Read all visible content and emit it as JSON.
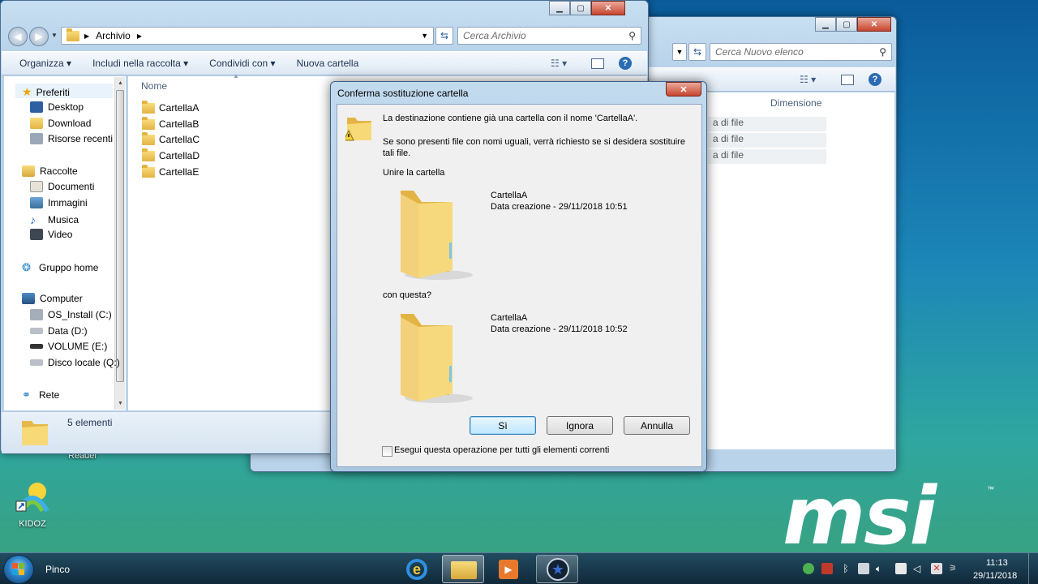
{
  "explorer": {
    "breadcrumb": "Archivio",
    "search_placeholder": "Cerca Archivio",
    "toolbar": {
      "organize": "Organizza",
      "include": "Includi nella raccolta",
      "share": "Condividi con",
      "new_folder": "Nuova cartella"
    },
    "sidebar": {
      "favorites": "Preferiti",
      "desktop": "Desktop",
      "download": "Download",
      "recent": "Risorse recenti",
      "libraries": "Raccolte",
      "documents": "Documenti",
      "images": "Immagini",
      "music": "Musica",
      "video": "Video",
      "homegroup": "Gruppo home",
      "computer": "Computer",
      "drive_c": "OS_Install (C:)",
      "drive_d": "Data (D:)",
      "drive_e": "VOLUME (E:)",
      "drive_q": "Disco locale (Q:)",
      "network": "Rete"
    },
    "column_name": "Nome",
    "files": [
      "CartellaA",
      "CartellaB",
      "CartellaC",
      "CartellaD",
      "CartellaE"
    ],
    "status": "5 elementi"
  },
  "back_window": {
    "search_placeholder": "Cerca Nuovo elenco",
    "column_size": "Dimensione",
    "rows": [
      "a di file",
      "a di file",
      "a di file"
    ]
  },
  "dialog": {
    "title": "Conferma sostituzione cartella",
    "message": "La destinazione contiene già una cartella con il nome 'CartellaA'.",
    "info": "Se sono presenti file con nomi uguali, verrà richiesto se si desidera sostituire tali file.",
    "merge_label": "Unire la cartella",
    "target": {
      "name": "CartellaA",
      "date": "Data creazione - 29/11/2018 10:51"
    },
    "with_label": "con questa?",
    "source": {
      "name": "CartellaA",
      "date": "Data creazione - 29/11/2018 10:52"
    },
    "buttons": {
      "yes": "Sì",
      "skip": "Ignora",
      "cancel": "Annulla"
    },
    "apply_all": "Esegui questa operazione per tutti gli elementi correnti",
    "apply_all_checked": false
  },
  "desktop": {
    "icon_label": "KIDOZ",
    "reader_label": "Reader",
    "logo": "msi",
    "logo_tm": "™"
  },
  "taskbar": {
    "user": "Pinco",
    "time": "11:13",
    "date": "29/11/2018"
  },
  "colors": {
    "accent": "#2b7ec4",
    "close_red": "#c8452e",
    "window_frame": "#b9d3ea"
  }
}
